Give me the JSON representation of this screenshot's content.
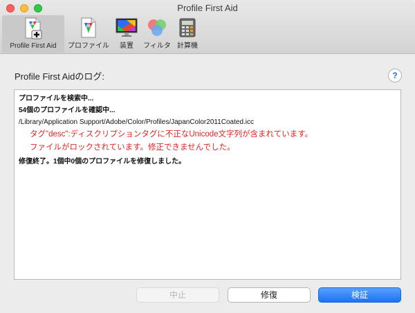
{
  "window": {
    "title": "Profile First Aid"
  },
  "toolbar": {
    "items": [
      {
        "label": "Profile First Aid",
        "icon": "profile-first-aid-icon",
        "selected": true
      },
      {
        "label": "プロファイル",
        "icon": "profile-icon",
        "selected": false
      },
      {
        "label": "装置",
        "icon": "display-icon",
        "selected": false
      },
      {
        "label": "フィルタ",
        "icon": "filter-icon",
        "selected": false
      },
      {
        "label": "計算機",
        "icon": "calculator-icon",
        "selected": false
      }
    ]
  },
  "main": {
    "log_label": "Profile First Aidのログ:",
    "help_label": "?",
    "log_lines": [
      "プロファイルを検索中...",
      "54個のプロファイルを確認中...",
      "/Library/Application Support/Adobe/Color/Profiles/JapanColor2011Coated.icc",
      "タグ\"desc\":ディスクリプションタグに不正なUnicode文字列が含まれています。",
      "ファイルがロックされています。修正できませんでした。",
      "修復終了。1個中0個のプロファイルを修復しました。"
    ]
  },
  "buttons": {
    "stop": "中止",
    "repair": "修復",
    "verify": "検証"
  },
  "colors": {
    "error_text": "#e02424",
    "accent_button": "#1a73f3"
  }
}
